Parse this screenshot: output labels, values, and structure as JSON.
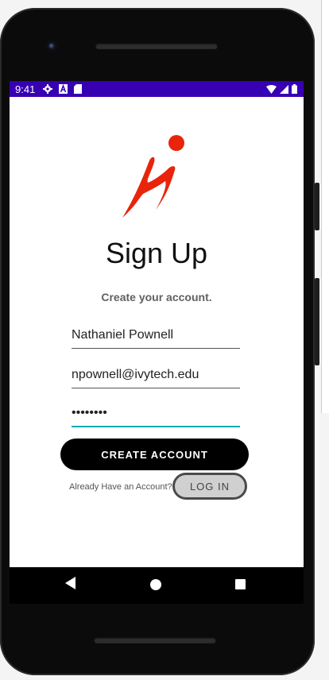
{
  "status_bar": {
    "time": "9:41",
    "left_icons": [
      "settings-icon",
      "a-icon",
      "sd-card-icon"
    ],
    "right_icons": [
      "wifi-icon",
      "signal-icon",
      "battery-icon"
    ],
    "color": "#3700b3"
  },
  "app": {
    "logo_color": "#e8240a",
    "title": "Sign Up",
    "subtitle": "Create your account."
  },
  "form": {
    "name_value": "Nathaniel Pownell",
    "email_value": "npownell@ivytech.edu",
    "password_value": "••••••••",
    "focus_color": "#00a8b5"
  },
  "actions": {
    "create_account_label": "CREATE ACCOUNT",
    "login_prompt": "Already Have an Account?",
    "login_label": "LOG IN"
  },
  "nav_bar": {
    "buttons": [
      "back-icon",
      "home-icon",
      "recents-icon"
    ]
  }
}
